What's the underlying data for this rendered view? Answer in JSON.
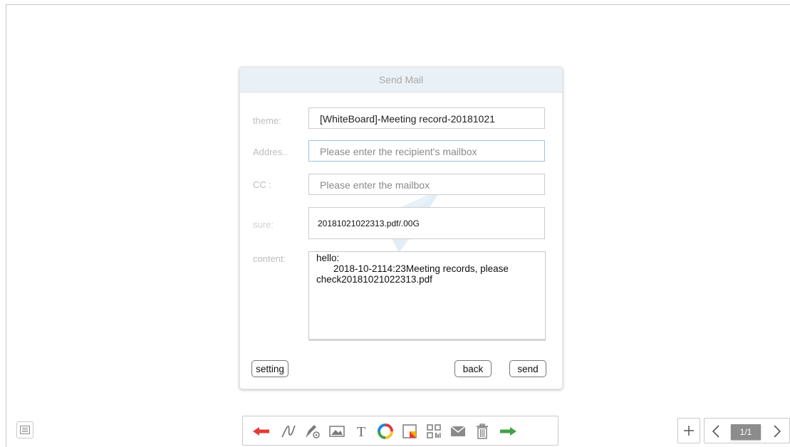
{
  "dialog": {
    "title": "Send Mail",
    "theme_label": "theme:",
    "theme_value": "[WhiteBoard]-Meeting record-20181021",
    "address_label": "Addres..",
    "address_placeholder": "Please enter the recipient's mailbox",
    "cc_label": "CC :",
    "cc_placeholder": "Please enter the mailbox",
    "attachment_label": "sure:",
    "attachment_value": "20181021022313.pdf/.00G",
    "content_label": "content:",
    "content_line1": "hello:",
    "content_line2": "2018-10-2114:23Meeting records, please",
    "content_line3": "check20181021022313.pdf",
    "buttons": {
      "setting": "setting",
      "back": "back",
      "send": "send"
    }
  },
  "toolbar": {
    "tools": [
      "undo-arrow",
      "pen",
      "pen-settings",
      "image",
      "text",
      "color-wheel",
      "sticky-note",
      "qr-code",
      "mail",
      "trash",
      "redo-arrow"
    ],
    "colors": {
      "undo": "#e53935",
      "redo": "#43a047",
      "icon": "#7a7a7a"
    }
  },
  "pager": {
    "indicator": "1/1"
  }
}
